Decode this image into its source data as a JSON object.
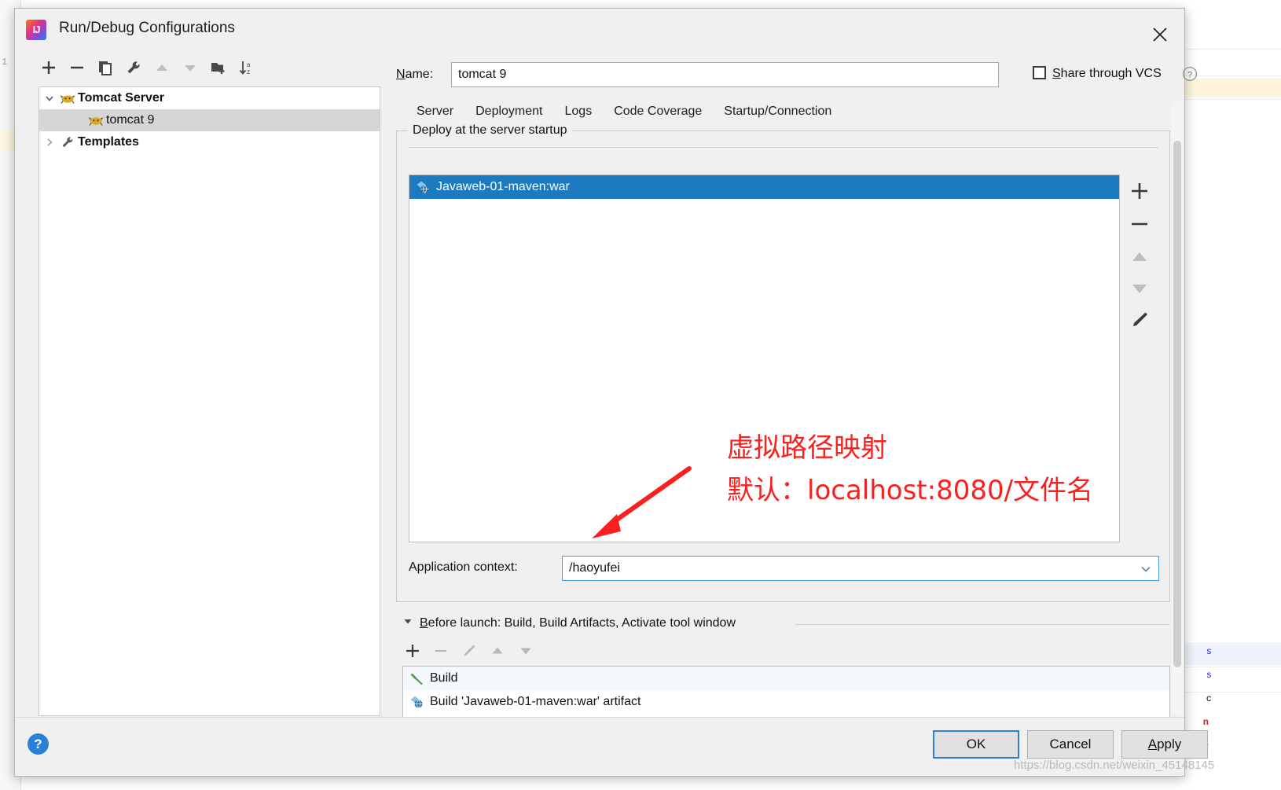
{
  "window": {
    "title": "Run/Debug Configurations",
    "app_icon": "intellij-idea-icon",
    "close_icon": "close-icon"
  },
  "toolbar": {
    "buttons": [
      {
        "name": "add-configuration-button",
        "icon": "plus-icon"
      },
      {
        "name": "remove-configuration-button",
        "icon": "minus-icon"
      },
      {
        "name": "copy-configuration-button",
        "icon": "copy-icon"
      },
      {
        "name": "edit-templates-button",
        "icon": "wrench-icon"
      },
      {
        "name": "move-up-button",
        "icon": "triangle-up-icon"
      },
      {
        "name": "move-down-button",
        "icon": "triangle-down-icon"
      },
      {
        "name": "move-into-folder-button",
        "icon": "folder-add-icon"
      },
      {
        "name": "sort-configurations-button",
        "icon": "sort-az-icon"
      }
    ]
  },
  "tree": {
    "items": [
      {
        "label": "Tomcat Server",
        "icon": "tomcat-icon",
        "expander": "chevron-down-icon",
        "bold": true,
        "indent": 0,
        "selected": false
      },
      {
        "label": "tomcat 9",
        "icon": "tomcat-icon",
        "expander": "",
        "bold": false,
        "indent": 1,
        "selected": true
      },
      {
        "label": "Templates",
        "icon": "wrench-icon",
        "expander": "chevron-right-icon",
        "bold": true,
        "indent": 0,
        "selected": false
      }
    ]
  },
  "name_field": {
    "label": "Name:",
    "label_mnemonic": "N",
    "value": "tomcat 9",
    "placeholder": "Name"
  },
  "share_vcs": {
    "label": "Share through VCS",
    "label_mnemonic": "S",
    "checked": false,
    "help_icon": "question-circle-icon"
  },
  "tabs": [
    {
      "label": "Server",
      "active": false
    },
    {
      "label": "Deployment",
      "active": true
    },
    {
      "label": "Logs",
      "active": false
    },
    {
      "label": "Code Coverage",
      "active": false
    },
    {
      "label": "Startup/Connection",
      "active": false
    }
  ],
  "deployment": {
    "group_title": "Deploy at the server startup",
    "artifacts": [
      {
        "label": "Javaweb-01-maven:war",
        "icon": "artifact-war-icon",
        "selected": true
      }
    ],
    "list_buttons": [
      {
        "name": "add-artifact-button",
        "icon": "plus-icon"
      },
      {
        "name": "remove-artifact-button",
        "icon": "minus-icon"
      },
      {
        "name": "move-artifact-up-button",
        "icon": "triangle-up-icon"
      },
      {
        "name": "move-artifact-down-button",
        "icon": "triangle-down-icon"
      },
      {
        "name": "edit-artifact-button",
        "icon": "pencil-icon"
      }
    ],
    "application_context": {
      "label": "Application context:",
      "value": "/haoyufei",
      "placeholder": "",
      "dropdown_icon": "chevron-down-icon"
    }
  },
  "before_launch": {
    "title": "Before launch: Build, Build Artifacts, Activate tool window",
    "title_mnemonic": "B",
    "collapse_icon": "triangle-down-icon",
    "buttons": [
      {
        "name": "add-task-button",
        "icon": "plus-icon"
      },
      {
        "name": "remove-task-button",
        "icon": "minus-icon"
      },
      {
        "name": "edit-task-button",
        "icon": "pencil-icon"
      },
      {
        "name": "move-task-up-button",
        "icon": "triangle-up-icon"
      },
      {
        "name": "move-task-down-button",
        "icon": "triangle-down-icon"
      }
    ],
    "tasks": [
      {
        "label": "Build",
        "icon": "hammer-icon"
      },
      {
        "label": "Build 'Javaweb-01-maven:war' artifact",
        "icon": "artifact-war-icon"
      }
    ]
  },
  "footer": {
    "help_icon": "question-circle-icon",
    "buttons": [
      {
        "label": "OK",
        "name": "ok-button",
        "primary": true
      },
      {
        "label": "Cancel",
        "name": "cancel-button",
        "primary": false
      },
      {
        "label": "Apply",
        "name": "apply-button",
        "primary": false,
        "mnemonic": "A"
      }
    ]
  },
  "annotation": {
    "line1": "虚拟路径映射",
    "line2": "默认：localhost:8080/文件名",
    "color": "#fa2020",
    "arrow_icon": "arrow-down-left-icon"
  },
  "watermark": "https://blog.csdn.net/weixin_45148145",
  "colors": {
    "accent": "#1c7ac0",
    "tab_underline": "#3d7ebf",
    "selection_gray": "#d6d6d6",
    "dialog_bg": "#f0f0f0",
    "annotation_red": "#fa2020",
    "help_blue": "#2b7fd4"
  }
}
